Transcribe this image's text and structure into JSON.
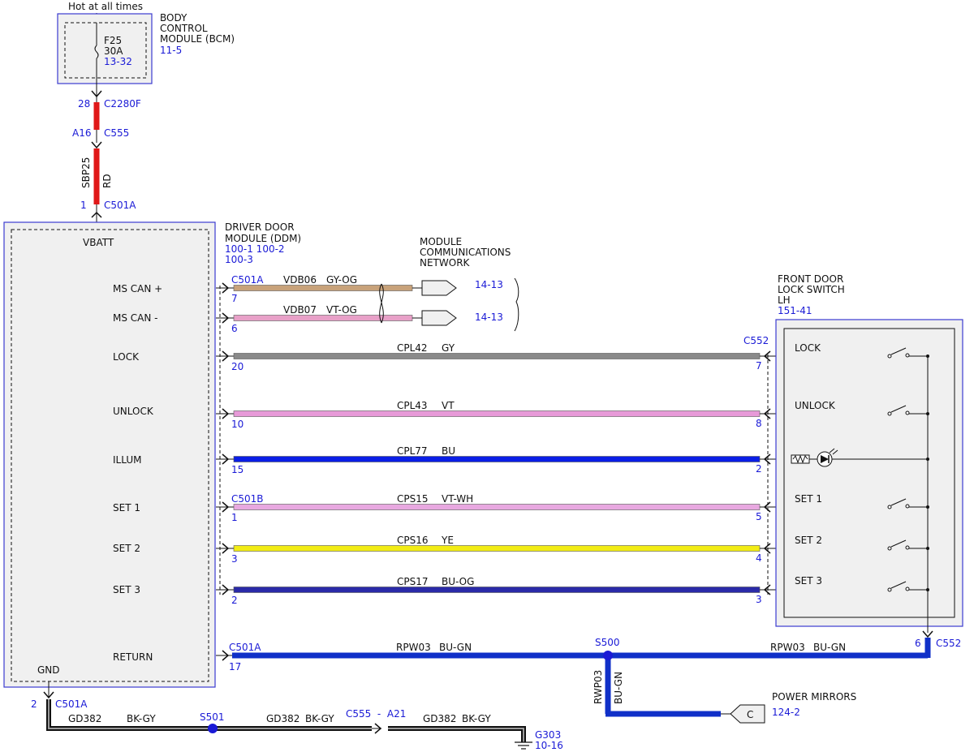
{
  "top_label": "Hot at all times",
  "bcm": {
    "name_lines": [
      "BODY",
      "CONTROL",
      "MODULE (BCM)"
    ],
    "page_ref": "11-5",
    "fuse": {
      "id": "F25",
      "rating": "30A",
      "ref": "13-32"
    }
  },
  "feed": {
    "c2280f_pin": "28",
    "c2280f": "C2280F",
    "c555_pin": "A16",
    "c555": "C555",
    "circuit": "SBP25",
    "color": "RD",
    "c501a_pin": "1",
    "c501a": "C501A"
  },
  "ddm": {
    "name_lines": [
      "DRIVER DOOR",
      "MODULE (DDM)"
    ],
    "refs_line1": "100-1  100-2",
    "refs_line2": "100-3",
    "vbatt": "VBATT",
    "gnd": "GND",
    "signals": [
      "MS CAN +",
      "MS CAN -",
      "LOCK",
      "UNLOCK",
      "ILLUM",
      "SET 1",
      "SET 2",
      "SET 3",
      "RETURN"
    ]
  },
  "mcn": {
    "label_lines": [
      "MODULE",
      "COMMUNICATIONS",
      "NETWORK"
    ],
    "ref1": "14-13",
    "ref2": "14-13"
  },
  "lock_switch": {
    "name_lines": [
      "FRONT DOOR",
      "LOCK SWITCH",
      "LH"
    ],
    "ref": "151-41",
    "connector": "C552",
    "labels": [
      "LOCK",
      "UNLOCK",
      "SET 1",
      "SET 2",
      "SET 3"
    ],
    "return_pin": "6",
    "return_connector": "C552"
  },
  "wires": [
    {
      "connector": "C501A",
      "pin_left": "7",
      "circuit": "VDB06",
      "color": "GY-OG",
      "pin_right": "",
      "hex": "#c8a27a"
    },
    {
      "connector": "",
      "pin_left": "6",
      "circuit": "VDB07",
      "color": "VT-OG",
      "pin_right": "",
      "hex": "#e8a0c8"
    },
    {
      "connector": "",
      "pin_left": "20",
      "circuit": "CPL42",
      "color": "GY",
      "pin_right": "7",
      "hex": "#8a8a8a"
    },
    {
      "connector": "",
      "pin_left": "10",
      "circuit": "CPL43",
      "color": "VT",
      "pin_right": "8",
      "hex": "#e79ad8"
    },
    {
      "connector": "",
      "pin_left": "15",
      "circuit": "CPL77",
      "color": "BU",
      "pin_right": "2",
      "hex": "#0a1ee6"
    },
    {
      "connector": "C501B",
      "pin_left": "1",
      "circuit": "CPS15",
      "color": "VT-WH",
      "pin_right": "5",
      "hex": "#e8a8e0"
    },
    {
      "connector": "",
      "pin_left": "3",
      "circuit": "CPS16",
      "color": "YE",
      "pin_right": "4",
      "hex": "#f2ec14"
    },
    {
      "connector": "",
      "pin_left": "2",
      "circuit": "CPS17",
      "color": "BU-OG",
      "pin_right": "3",
      "hex": "#2a2aa8"
    }
  ],
  "return_wire": {
    "connector": "C501A",
    "pin": "17",
    "circuit": "RPW03",
    "color": "BU-GN",
    "splice": "S500",
    "circuit_right": "RPW03",
    "color_right": "BU-GN",
    "branch_circuit": "RWP03",
    "branch_color": "BU-GN"
  },
  "power_mirrors": {
    "label": "POWER MIRRORS",
    "conn": "C",
    "ref": "124-2"
  },
  "ground": {
    "pin": "2",
    "connector": "C501A",
    "circuit1": "GD382",
    "color1": "BK-GY",
    "splice": "S501",
    "circuit2": "GD382",
    "color2": "BK-GY",
    "inline": "C555  -  A21",
    "circuit3": "GD382",
    "color3": "BK-GY",
    "ground_point": "G303",
    "ref": "10-16"
  },
  "colors": {
    "link_blue": "#1a1ad6",
    "module_border": "#3b3bd0",
    "module_fill": "#f0f0f0",
    "feed_red": "#e01818",
    "return_blue": "#1030c8"
  }
}
